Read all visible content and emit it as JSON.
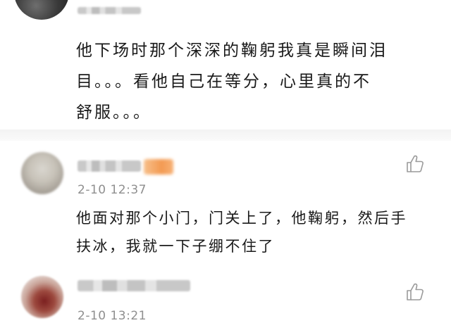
{
  "comments": [
    {
      "text_lines": [
        "他下场时那个深深的鞠躬我真是瞬间泪",
        "目。。。看他自己在等分，心里真的不",
        "舒服。。。"
      ]
    },
    {
      "time": "2-10 12:37",
      "text_lines": [
        "他面对那个小门，门关上了，他鞠躬，然后手",
        "扶冰，我就一下子绷不住了"
      ]
    },
    {
      "time": "2-10 13:21"
    }
  ],
  "icons": {
    "like": "thumbs-up-icon"
  },
  "colors": {
    "text": "#1a1a1a",
    "timestamp": "#8f8f8f",
    "divider": "#f3f3f3",
    "badge": "#f39a52"
  }
}
